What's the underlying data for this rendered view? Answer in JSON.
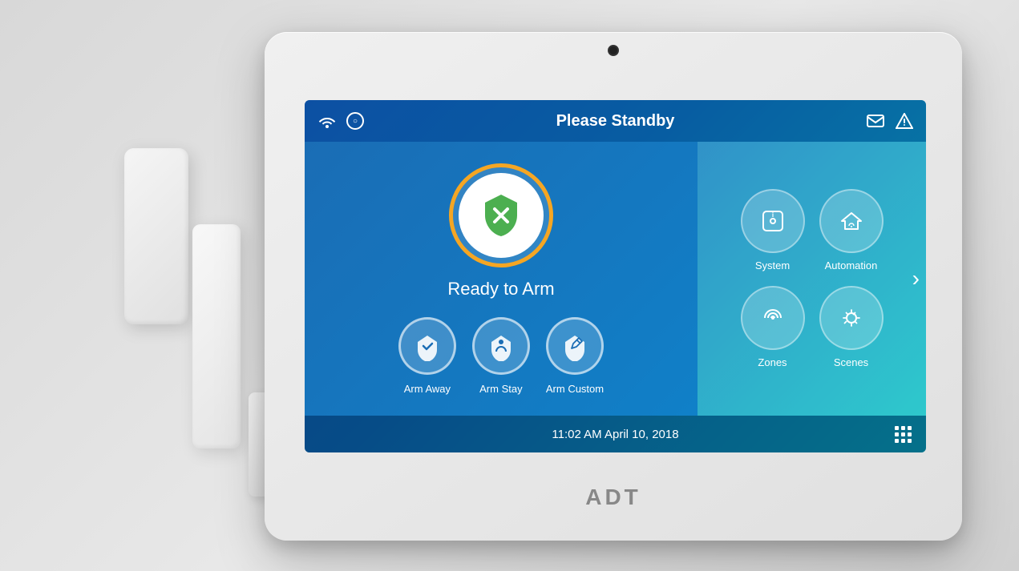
{
  "scene": {
    "background_color": "#e0e0e0"
  },
  "panel": {
    "camera_visible": true,
    "brand": "ADT"
  },
  "screen": {
    "header": {
      "title": "Please Standby",
      "wifi_icon": "wifi",
      "signal_icon": "circle",
      "mail_icon": "mail",
      "alert_icon": "alert-triangle"
    },
    "left": {
      "status_label": "Ready to Arm",
      "arm_buttons": [
        {
          "id": "arm-away",
          "label": "Arm Away",
          "icon": "check-shield"
        },
        {
          "id": "arm-stay",
          "label": "Arm Stay",
          "icon": "person-shield"
        },
        {
          "id": "arm-custom",
          "label": "Arm Custom",
          "icon": "pencil-shield"
        }
      ]
    },
    "right": {
      "menu_items": [
        {
          "id": "system",
          "label": "System",
          "icon": "info"
        },
        {
          "id": "automation",
          "label": "Automation",
          "icon": "home"
        },
        {
          "id": "zones",
          "label": "Zones",
          "icon": "signal"
        },
        {
          "id": "scenes",
          "label": "Scenes",
          "icon": "scenes"
        }
      ],
      "chevron": "›"
    },
    "footer": {
      "datetime": "11:02 AM April 10, 2018",
      "grid_icon": "grid"
    }
  }
}
